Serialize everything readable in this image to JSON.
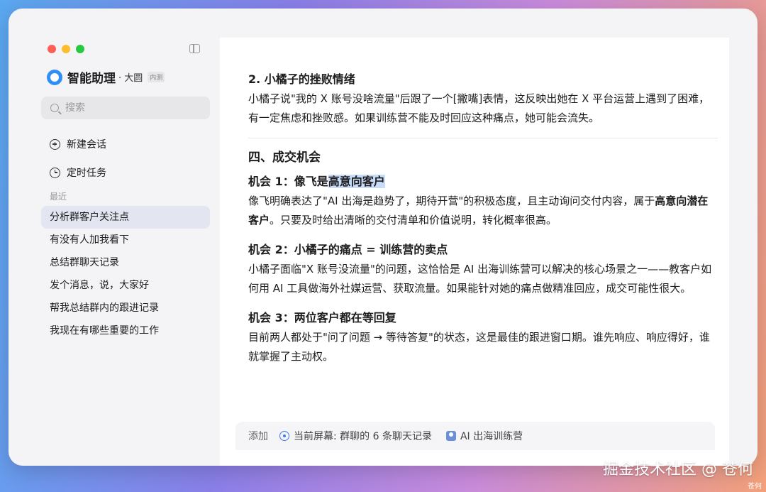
{
  "sidebar": {
    "brand": {
      "name": "智能助理",
      "user": "· 大圆",
      "badge": "内测"
    },
    "search": {
      "placeholder": "搜索"
    },
    "nav": {
      "new_chat": "新建会话",
      "scheduled": "定时任务"
    },
    "recent_label": "最近",
    "recent": [
      "分析群客户关注点",
      "有没有人加我看下",
      "总结群聊天记录",
      "发个消息，说，大家好",
      "帮我总结群内的跟进记录",
      "我现在有哪些重要的工作"
    ]
  },
  "main": {
    "s2_title": "2. 小橘子的挫败情绪",
    "s2_body": "小橘子说\"我的 X 账号没啥流量\"后跟了一个[撇嘴]表情，这反映出她在 X 平台运营上遇到了困难，有一定焦虑和挫败感。如果训练营不能及时回应这种痛点，她可能会流失。",
    "section4_title": "四、成交机会",
    "o1_title_pre": "机会 1：像飞是",
    "o1_title_hl": "高意向客户",
    "o1_body_pre": "像飞明确表达了\"AI 出海是趋势了，期待开营\"的积极态度，且主动询问交付内容，属于",
    "o1_body_strong": "高意向潜在客户",
    "o1_body_post": "。只要及时给出清晰的交付清单和价值说明，转化概率很高。",
    "o2_title": "机会 2：小橘子的痛点 = 训练营的卖点",
    "o2_body": "小橘子面临\"X 账号没流量\"的问题，这恰恰是 AI 出海训练营可以解决的核心场景之一——教客户如何用 AI 工具做海外社媒运营、获取流量。如果能针对她的痛点做精准回应，成交可能性很大。",
    "o3_title": "机会 3：两位客户都在等回复",
    "o3_body": "目前两人都处于\"问了问题 → 等待答复\"的状态，这是最佳的跟进窗口期。谁先响应、响应得好，谁就掌握了主动权。"
  },
  "footer": {
    "add": "添加",
    "screen": "当前屏幕: 群聊的 6 条聊天记录",
    "group": "AI 出海训练营"
  },
  "watermark": {
    "main": "掘金技术社区 @ 苍何",
    "small": "苍何"
  }
}
